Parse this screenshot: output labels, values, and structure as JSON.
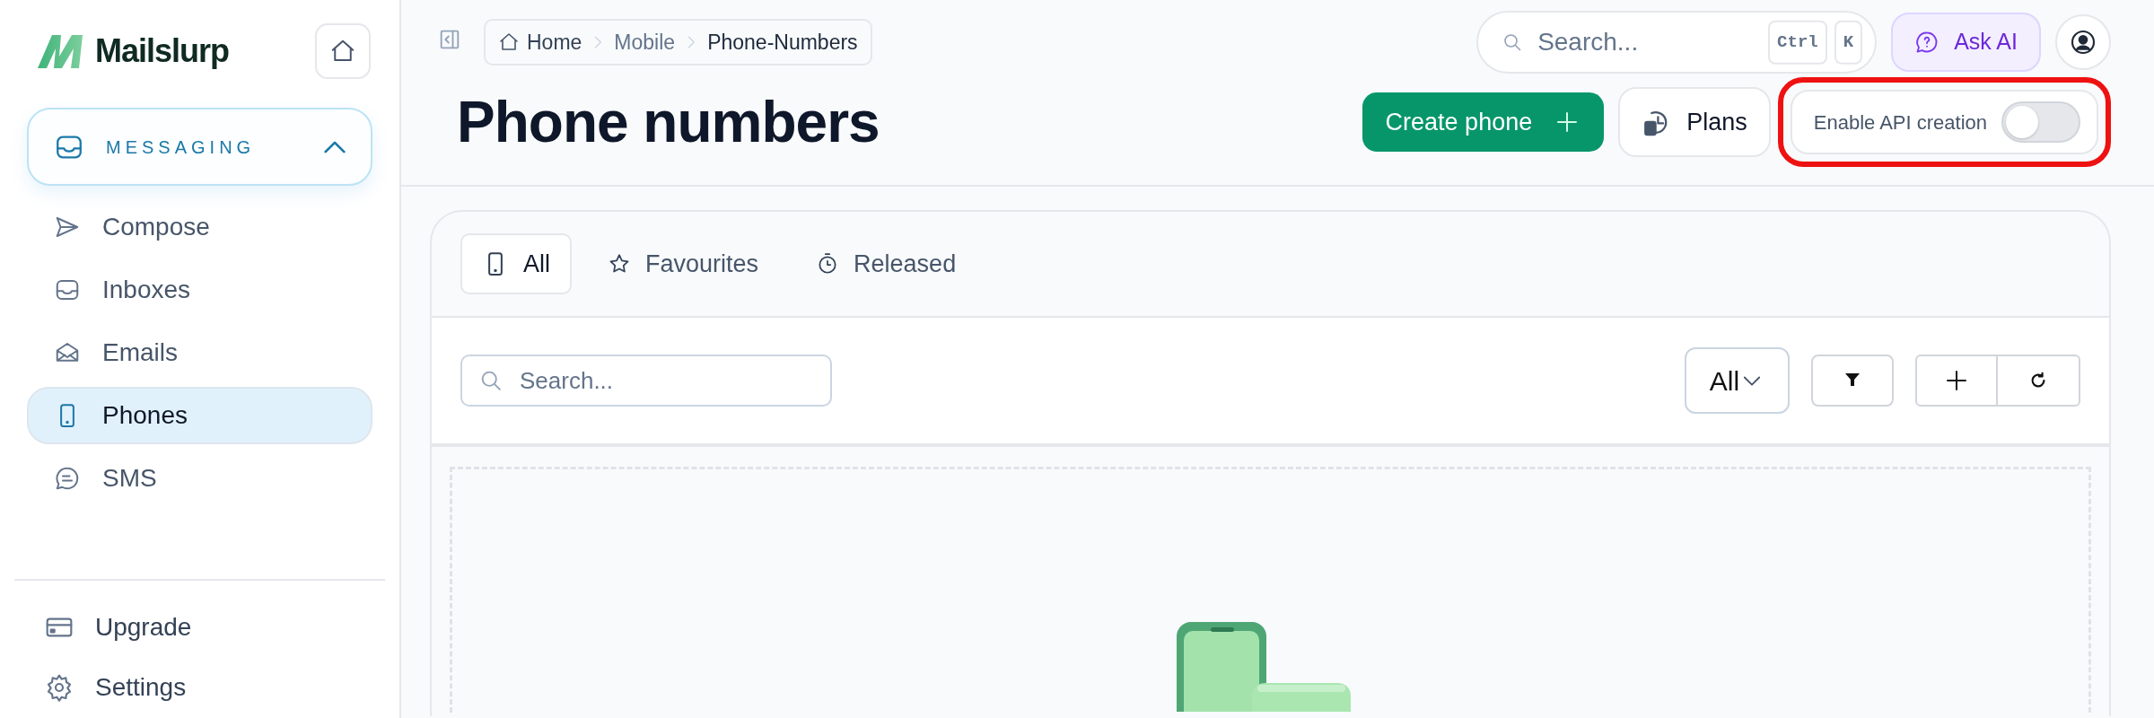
{
  "sidebar": {
    "logo": "Mailslurp",
    "group": {
      "label": "MESSAGING",
      "expanded": true,
      "items": [
        {
          "label": "Compose",
          "selected": false
        },
        {
          "label": "Inboxes",
          "selected": false
        },
        {
          "label": "Emails",
          "selected": false
        },
        {
          "label": "Phones",
          "selected": true
        },
        {
          "label": "SMS",
          "selected": false
        }
      ]
    },
    "footer_items": [
      {
        "label": "Upgrade"
      },
      {
        "label": "Settings"
      }
    ]
  },
  "breadcrumb": [
    "Home",
    "Mobile",
    "Phone-Numbers"
  ],
  "search": {
    "placeholder": "Search...",
    "keys": [
      "Ctrl",
      "K"
    ]
  },
  "ask_ai": "Ask AI",
  "title": "Phone numbers",
  "create_button": "Create phone",
  "plans_button": "Plans",
  "api_toggle": {
    "label": "Enable API creation",
    "on": false,
    "highlighted": true
  },
  "tabs": [
    {
      "label": "All",
      "selected": true
    },
    {
      "label": "Favourites",
      "selected": false
    },
    {
      "label": "Released",
      "selected": false
    }
  ],
  "toolbar": {
    "search_placeholder": "Search...",
    "select_value": "All"
  }
}
